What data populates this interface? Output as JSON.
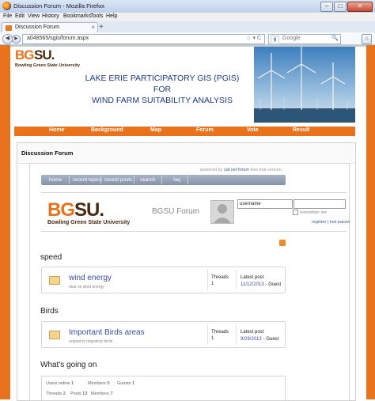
{
  "window": {
    "title": "Discussion Forum - Mozilla Firefox",
    "controls": [
      "–",
      "□",
      "✕"
    ]
  },
  "menu": [
    "File",
    "Edit",
    "View",
    "History",
    "Bookmarks",
    "Tools",
    "Help"
  ],
  "tab": {
    "label": "Discussion Forum",
    "close": "×",
    "new": "+"
  },
  "nav": {
    "back": "◀",
    "forward": "▶",
    "url": "a048565/sgis/forum.aspx",
    "url_icons": "☆ ▾ C",
    "search_engine": "g",
    "search_placeholder": "Google",
    "search_go": "🔍",
    "home": "⌂"
  },
  "banner": {
    "logo_bg": "BG",
    "logo_su": "SU.",
    "logo_university": "Bowling Green State University",
    "title_line1": "LAKE ERIE PARTICIPATORY GIS (PGIS)",
    "title_line2": "FOR",
    "title_line3": "WIND FARM SUITABILITY ANALYSIS"
  },
  "site_nav": [
    "Home",
    "Background",
    "Map",
    "Forum",
    "Vote",
    "Result"
  ],
  "page_heading": "Discussion Forum",
  "powered_by": {
    "prefix": "powered by",
    "link": "yaf.net forum",
    "suffix": "free trial version."
  },
  "forum_tabs": [
    "home",
    "recent topics",
    "recent posts",
    "search",
    "faq"
  ],
  "forum_header": {
    "logo_bg": "BG",
    "logo_su": "SU.",
    "logo_university": "Bowling Green State University",
    "forum_name": "BGSU Forum",
    "username_value": "username",
    "remember_label": "remember me",
    "register_link": "register",
    "lost_password_link": "lost passw"
  },
  "categories": [
    {
      "name": "speed",
      "forum": {
        "title": "wind energy",
        "description": "deal on wind energy",
        "threads_label": "Threads",
        "threads": "1",
        "last_post_label": "Latest post",
        "last_post_date": "11/12/2013",
        "last_post_by": "- Guest"
      }
    },
    {
      "name": "Birds",
      "forum": {
        "title": "Important Birds areas",
        "description": "related to migratory birds",
        "threads_label": "Threads",
        "threads": "1",
        "last_post_label": "Latest post",
        "last_post_date": "9/29/2013",
        "last_post_by": "- Guest"
      }
    }
  ],
  "whats_going_on": {
    "heading": "What's going on",
    "users_online_label": "Users online",
    "users_online": "1",
    "members_label": "Members",
    "members": "0",
    "guests_label": "Guests",
    "guests": "1",
    "threads_label": "Threads",
    "threads": "2",
    "posts_label": "Posts",
    "posts": "13",
    "members_total_label": "Members",
    "members_total": "7"
  },
  "colors": {
    "brand_orange": "#e8731c",
    "brand_brown": "#4a2a10",
    "title_blue": "#1b3a8c",
    "link_blue": "#3b4ea0"
  }
}
